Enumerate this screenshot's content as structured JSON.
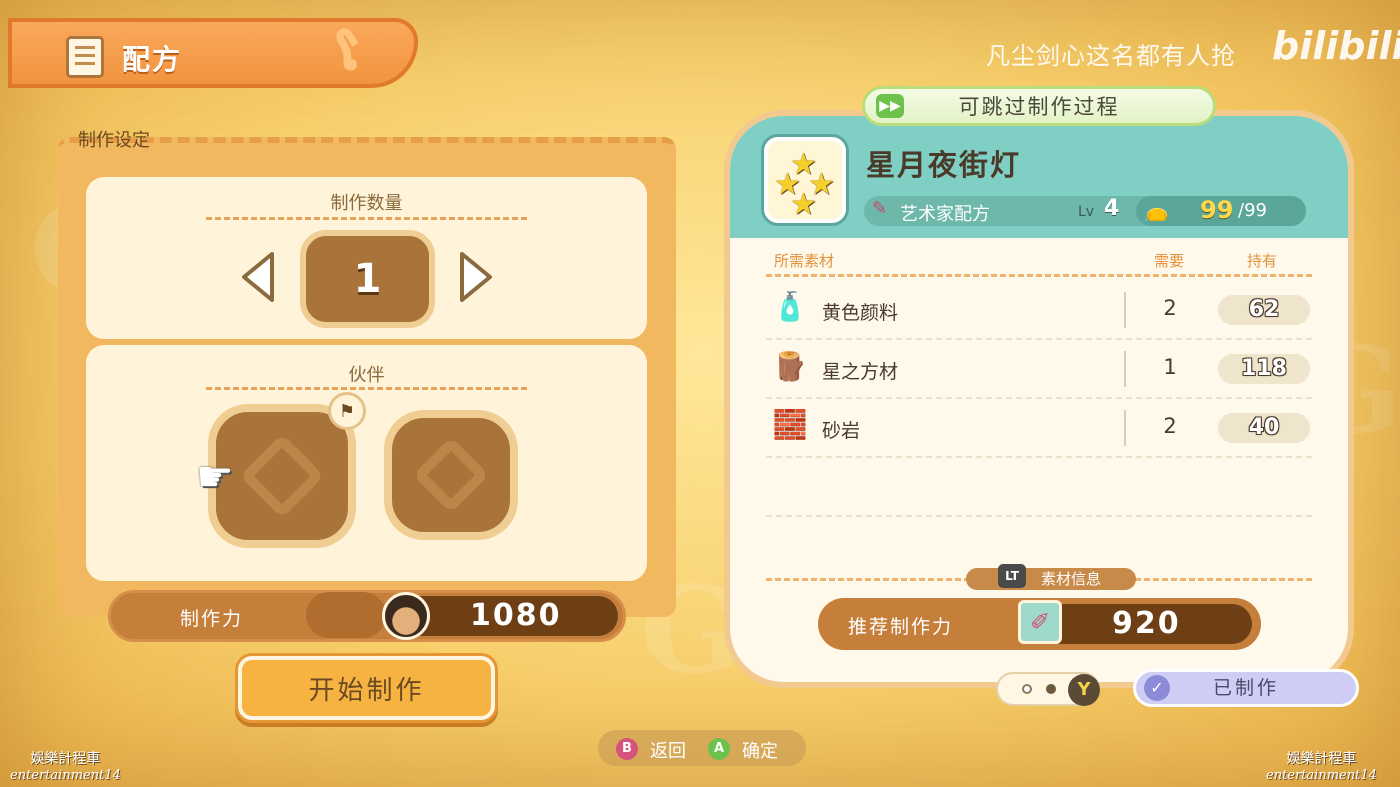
{
  "header": {
    "title": "配方"
  },
  "watermarks": {
    "top": "凡尘剑心这名都有人抢",
    "brand": "bilibili",
    "corner_cn": "娛樂計程車",
    "corner_en": "entertainment14"
  },
  "craft_settings": {
    "section_label": "制作设定",
    "quantity": {
      "title": "制作数量",
      "value": "1"
    },
    "partner": {
      "title": "伙伴"
    },
    "power": {
      "label": "制作力",
      "value": "1080"
    },
    "start_button": "开始制作"
  },
  "recipe": {
    "skip_label": "可跳过制作过程",
    "name": "星月夜街灯",
    "type": "艺术家配方",
    "level_label": "Lv",
    "level": "4",
    "stock_current": "99",
    "stock_max": "/99",
    "columns": {
      "materials": "所需素材",
      "need": "需要",
      "have": "持有"
    },
    "materials": [
      {
        "icon": "yellow-paint-icon",
        "name": "黄色颜料",
        "need": "2",
        "have": "62"
      },
      {
        "icon": "star-lumber-icon",
        "name": "星之方材",
        "need": "1",
        "have": "118"
      },
      {
        "icon": "sandstone-icon",
        "name": "砂岩",
        "need": "2",
        "have": "40"
      }
    ],
    "material_info_button": "LT",
    "material_info_label": "素材信息",
    "recommended_label": "推荐制作力",
    "recommended_value": "920",
    "made_label": "已制作",
    "page_button": "Y"
  },
  "hints": {
    "back_key": "B",
    "back_label": "返回",
    "confirm_key": "A",
    "confirm_label": "确定"
  },
  "colors": {
    "accent_orange": "#f2943f",
    "teal_header": "#7fcfc4",
    "bar_brown": "#c57f3a",
    "hint_b": "#d6547a",
    "hint_a": "#6cc24a"
  }
}
